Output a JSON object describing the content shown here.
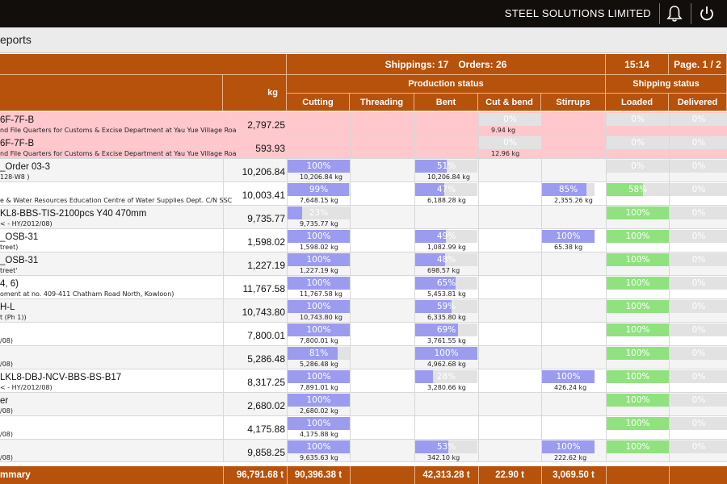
{
  "header": {
    "company": "STEEL SOLUTIONS LIMITED",
    "bell_icon": "bell-icon",
    "power_icon": "power-icon"
  },
  "subheader": {
    "title": "eports"
  },
  "summary_bar": {
    "shippings": "Shippings: 17",
    "orders": "Orders: 26",
    "time": "15:14",
    "page": "Page. 1 / 2"
  },
  "columns": {
    "kg": "kg",
    "production_group": "Production status",
    "shipping_group": "Shipping status",
    "cutting": "Cutting",
    "threading": "Threading",
    "bent": "Bent",
    "cut_bend": "Cut & bend",
    "stirrups": "Stirrups",
    "loaded": "Loaded",
    "delivered": "Delivered"
  },
  "colors": {
    "brand": "#b6520c",
    "progress": "#9b9bf0",
    "shipping": "#8fe27e",
    "alert_row": "#ffc8cd",
    "bar_track": "#e2e2e2"
  },
  "rows": [
    {
      "style": "alert",
      "title": "6F-7F-B",
      "subtitle": "nd File Quarters for Customs & Excise Department at Yau Yue Village Roa",
      "kg": "2,797.25",
      "cutting": null,
      "threading": null,
      "bent": null,
      "cut_bend": {
        "label": "0%",
        "pct": 0,
        "kg": "9.94 kg"
      },
      "stirrups": null,
      "loaded": {
        "label": "0%",
        "pct": 0
      },
      "delivered": {
        "label": "0%",
        "pct": 0
      }
    },
    {
      "style": "alert",
      "title": "6F-7F-B",
      "subtitle": "nd File Quarters for Customs & Excise Department at Yau Yue Village Roa",
      "kg": "593.93",
      "cutting": null,
      "threading": null,
      "bent": null,
      "cut_bend": {
        "label": "0%",
        "pct": 0,
        "kg": "12.96 kg"
      },
      "stirrups": null,
      "loaded": {
        "label": "0%",
        "pct": 0
      },
      "delivered": {
        "label": "0%",
        "pct": 0
      }
    },
    {
      "style": "alt",
      "title": "_Order 03-3",
      "subtitle": "128-W8 )",
      "kg": "10,206.84",
      "cutting": {
        "label": "100%",
        "pct": 100,
        "kg": "10,206.84 kg"
      },
      "threading": null,
      "bent": {
        "label": "51%",
        "pct": 51,
        "kg": "10,206.84 kg"
      },
      "cut_bend": null,
      "stirrups": null,
      "loaded": {
        "label": "0%",
        "pct": 0
      },
      "delivered": {
        "label": "0%",
        "pct": 0
      }
    },
    {
      "style": "plain",
      "title": "",
      "subtitle": "e & Water Resources Education Centre of Water Supplies Dept. C/N SSC",
      "kg": "10,003.41",
      "cutting": {
        "label": "99%",
        "pct": 99,
        "kg": "7,648.15 kg"
      },
      "threading": null,
      "bent": {
        "label": "47%",
        "pct": 47,
        "kg": "6,188.28 kg"
      },
      "cut_bend": null,
      "stirrups": {
        "label": "85%",
        "pct": 85,
        "kg": "2,355.26 kg"
      },
      "loaded": {
        "label": "58%",
        "pct": 58
      },
      "delivered": {
        "label": "0%",
        "pct": 0
      }
    },
    {
      "style": "alt",
      "title": "KL8-BBS-TIS-2100pcs Y40 470mm",
      "subtitle": "< - HY/2012/08)",
      "kg": "9,735.77",
      "cutting": {
        "label": "23%",
        "pct": 23,
        "kg": "9,735.77 kg"
      },
      "threading": null,
      "bent": null,
      "cut_bend": null,
      "stirrups": null,
      "loaded": {
        "label": "100%",
        "pct": 100
      },
      "delivered": {
        "label": "0%",
        "pct": 0
      }
    },
    {
      "style": "plain",
      "title": "_OSB-31",
      "subtitle": "treet)",
      "kg": "1,598.02",
      "cutting": {
        "label": "100%",
        "pct": 100,
        "kg": "1,598.02 kg"
      },
      "threading": null,
      "bent": {
        "label": "49%",
        "pct": 49,
        "kg": "1,082.99 kg"
      },
      "cut_bend": null,
      "stirrups": {
        "label": "100%",
        "pct": 100,
        "kg": "65.38 kg"
      },
      "loaded": {
        "label": "100%",
        "pct": 100
      },
      "delivered": {
        "label": "0%",
        "pct": 0
      }
    },
    {
      "style": "alt",
      "title": "_OSB-31",
      "subtitle": "treet'",
      "kg": "1,227.19",
      "cutting": {
        "label": "100%",
        "pct": 100,
        "kg": "1,227.19 kg"
      },
      "threading": null,
      "bent": {
        "label": "48%",
        "pct": 48,
        "kg": "698.57 kg"
      },
      "cut_bend": null,
      "stirrups": null,
      "loaded": {
        "label": "100%",
        "pct": 100
      },
      "delivered": {
        "label": "0%",
        "pct": 0
      }
    },
    {
      "style": "plain",
      "title": "4, 6)",
      "subtitle": "oment at no. 409-411 Chatham Road North, Kowloon)",
      "kg": "11,767.58",
      "cutting": {
        "label": "100%",
        "pct": 100,
        "kg": "11,767.58 kg"
      },
      "threading": null,
      "bent": {
        "label": "65%",
        "pct": 65,
        "kg": "5,453.81 kg"
      },
      "cut_bend": null,
      "stirrups": null,
      "loaded": {
        "label": "100%",
        "pct": 100
      },
      "delivered": {
        "label": "0%",
        "pct": 0
      }
    },
    {
      "style": "alt",
      "title": "H-L",
      "subtitle": "t (Ph 1))",
      "kg": "10,743.80",
      "cutting": {
        "label": "100%",
        "pct": 100,
        "kg": "10,743.80 kg"
      },
      "threading": null,
      "bent": {
        "label": "59%",
        "pct": 59,
        "kg": "6,335.80 kg"
      },
      "cut_bend": null,
      "stirrups": null,
      "loaded": {
        "label": "100%",
        "pct": 100
      },
      "delivered": {
        "label": "0%",
        "pct": 0
      }
    },
    {
      "style": "plain",
      "title": "",
      "subtitle": "/08)",
      "kg": "7,800.01",
      "cutting": {
        "label": "100%",
        "pct": 100,
        "kg": "7,800.01 kg"
      },
      "threading": null,
      "bent": {
        "label": "69%",
        "pct": 69,
        "kg": "3,761.55 kg"
      },
      "cut_bend": null,
      "stirrups": null,
      "loaded": {
        "label": "100%",
        "pct": 100
      },
      "delivered": {
        "label": "0%",
        "pct": 0
      }
    },
    {
      "style": "alt",
      "title": "",
      "subtitle": "/08)",
      "kg": "5,286.48",
      "cutting": {
        "label": "81%",
        "pct": 81,
        "kg": "5,286.48 kg"
      },
      "threading": null,
      "bent": {
        "label": "100%",
        "pct": 100,
        "kg": "4,962.68 kg"
      },
      "cut_bend": null,
      "stirrups": null,
      "loaded": {
        "label": "100%",
        "pct": 100
      },
      "delivered": {
        "label": "0%",
        "pct": 0
      }
    },
    {
      "style": "plain",
      "title": "LKL8-DBJ-NCV-BBS-BS-B17",
      "subtitle": "< - HY/2012/08)",
      "kg": "8,317.25",
      "cutting": {
        "label": "100%",
        "pct": 100,
        "kg": "7,891.01 kg"
      },
      "threading": null,
      "bent": {
        "label": "28%",
        "pct": 28,
        "kg": "3,280.66 kg"
      },
      "cut_bend": null,
      "stirrups": {
        "label": "100%",
        "pct": 100,
        "kg": "426.24 kg"
      },
      "loaded": {
        "label": "100%",
        "pct": 100
      },
      "delivered": {
        "label": "0%",
        "pct": 0
      }
    },
    {
      "style": "alt",
      "title": "er",
      "subtitle": "/08)",
      "kg": "2,680.02",
      "cutting": {
        "label": "100%",
        "pct": 100,
        "kg": "2,680.02 kg"
      },
      "threading": null,
      "bent": null,
      "cut_bend": null,
      "stirrups": null,
      "loaded": {
        "label": "100%",
        "pct": 100
      },
      "delivered": {
        "label": "0%",
        "pct": 0
      }
    },
    {
      "style": "plain",
      "title": "",
      "subtitle": "/08)",
      "kg": "4,175.88",
      "cutting": {
        "label": "100%",
        "pct": 100,
        "kg": "4,175.88 kg"
      },
      "threading": null,
      "bent": null,
      "cut_bend": null,
      "stirrups": null,
      "loaded": {
        "label": "100%",
        "pct": 100
      },
      "delivered": {
        "label": "0%",
        "pct": 0
      }
    },
    {
      "style": "alt",
      "title": "",
      "subtitle": "/08)",
      "kg": "9,858.25",
      "cutting": {
        "label": "100%",
        "pct": 100,
        "kg": "9,635.63 kg"
      },
      "threading": null,
      "bent": {
        "label": "53%",
        "pct": 53,
        "kg": "342.10 kg"
      },
      "cut_bend": null,
      "stirrups": {
        "label": "100%",
        "pct": 100,
        "kg": "222.62 kg"
      },
      "loaded": {
        "label": "100%",
        "pct": 100
      },
      "delivered": {
        "label": "0%",
        "pct": 0
      }
    }
  ],
  "summary": {
    "label": "mmary",
    "kg": "96,791.68 t",
    "cutting": "90,396.38 t",
    "threading": "",
    "bent": "42,313.28 t",
    "cut_bend": "22.90 t",
    "stirrups": "3,069.50 t",
    "loaded": "",
    "delivered": ""
  }
}
